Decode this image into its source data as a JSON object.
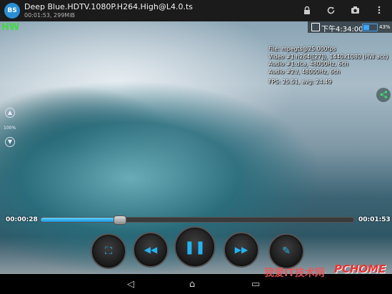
{
  "header": {
    "app_logo_text": "BS",
    "file_title": "Deep Blue.HDTV.1080P.H264.High@L4.0.ts",
    "file_meta": "00:01:53, 299MiB",
    "icons": [
      "lock-icon",
      "rotate-icon",
      "camera-icon",
      "menu-icon"
    ]
  },
  "status": {
    "hw_badge": "HW",
    "clock": "下午4:34:00",
    "battery_pct": "43%",
    "battery_level": 0.43
  },
  "stream_info": {
    "file": "File: mpegts@25.000fps",
    "video": "Video #1:h264([27]), 1440x1080 (HW acc)",
    "audio1": "Audio #1:dca, 48000Hz, 6ch",
    "audio2": "Audio #2:/, 48000Hz, 6ch",
    "fps": "FPS: 25.51, avg: 24.49"
  },
  "zoom": {
    "level": "100%",
    "up_icon": "▲",
    "down_icon": "▼"
  },
  "playback": {
    "current_time": "00:00:28",
    "total_time": "00:01:53",
    "progress": 0.25
  },
  "controls": {
    "aspect": "⛶",
    "rewind": "◀◀",
    "pause": "❚❚",
    "forward": "▶▶",
    "edit": "✎"
  },
  "nav": {
    "back": "◁",
    "home": "⌂",
    "recents": "▭"
  },
  "watermark": {
    "cn": "我爱IT技术网",
    "brand": "PCHOME"
  },
  "colors": {
    "accent": "#23b3f2",
    "hw": "#3fdc3f"
  }
}
